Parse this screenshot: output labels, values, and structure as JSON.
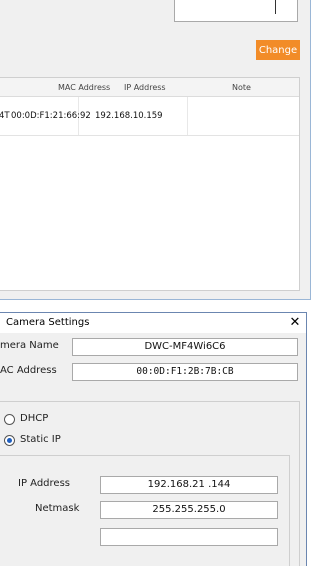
{
  "main": {
    "change_label": "Change",
    "columns": [
      "MAC Address",
      "IP Address",
      "Note"
    ],
    "row": {
      "model_fragment": "4T",
      "mac": "00:0D:F1:21:66:92",
      "ip": "192.168.10.159",
      "note": ""
    }
  },
  "dialog": {
    "title": "Camera Settings",
    "close_glyph": "✕",
    "camera_name_label": "mera Name",
    "camera_name_value": "DWC-MF4Wi6C6",
    "mac_label": "AC Address",
    "mac_value": "00:0D:F1:2B:7B:CB",
    "dhcp_label": "DHCP",
    "static_label": "Static IP",
    "ip_label": "IP Address",
    "ip_value": "192.168.21 .144",
    "netmask_label": "Netmask",
    "netmask_value": "255.255.255.0",
    "mode": "static"
  }
}
